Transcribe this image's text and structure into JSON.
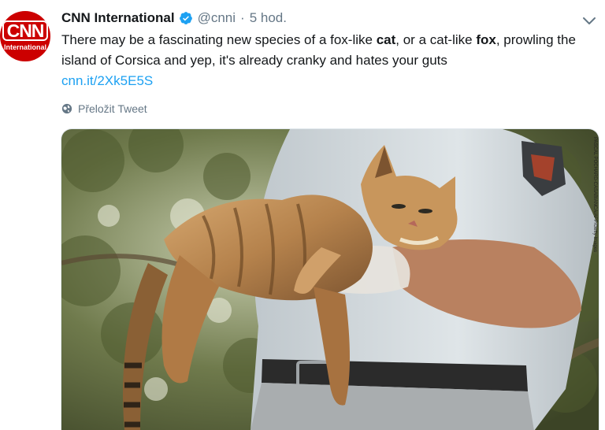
{
  "account": {
    "name": "CNN International",
    "handle": "@cnni",
    "separator": "·",
    "time": "5 hod.",
    "avatar": {
      "logo_text": "CNN",
      "sub_text": "International",
      "color": "#cc0000"
    },
    "verified_icon": "verified-badge-icon"
  },
  "tweet": {
    "segments": [
      {
        "text": "There may be a fascinating new species of a fox-like ",
        "bold": false
      },
      {
        "text": "cat",
        "bold": true
      },
      {
        "text": ", or a cat-like ",
        "bold": false
      },
      {
        "text": "fox",
        "bold": true
      },
      {
        "text": ", prowling the island of Corsica and yep, it's already cranky and hates your guts",
        "bold": false
      }
    ],
    "link": "cnn.it/2Xk5E5S"
  },
  "translate": {
    "label": "Přeložit Tweet",
    "icon": "globe-icon"
  },
  "menu": {
    "icon": "chevron-down-icon"
  },
  "media": {
    "alt": "photo-cat-fox-held-by-ranger",
    "credit": "PASCAL POCHARD-CASABIANCA/AFP/Getty Images"
  },
  "colors": {
    "accent": "#1da1f2",
    "text": "#14171a",
    "muted": "#657786"
  }
}
